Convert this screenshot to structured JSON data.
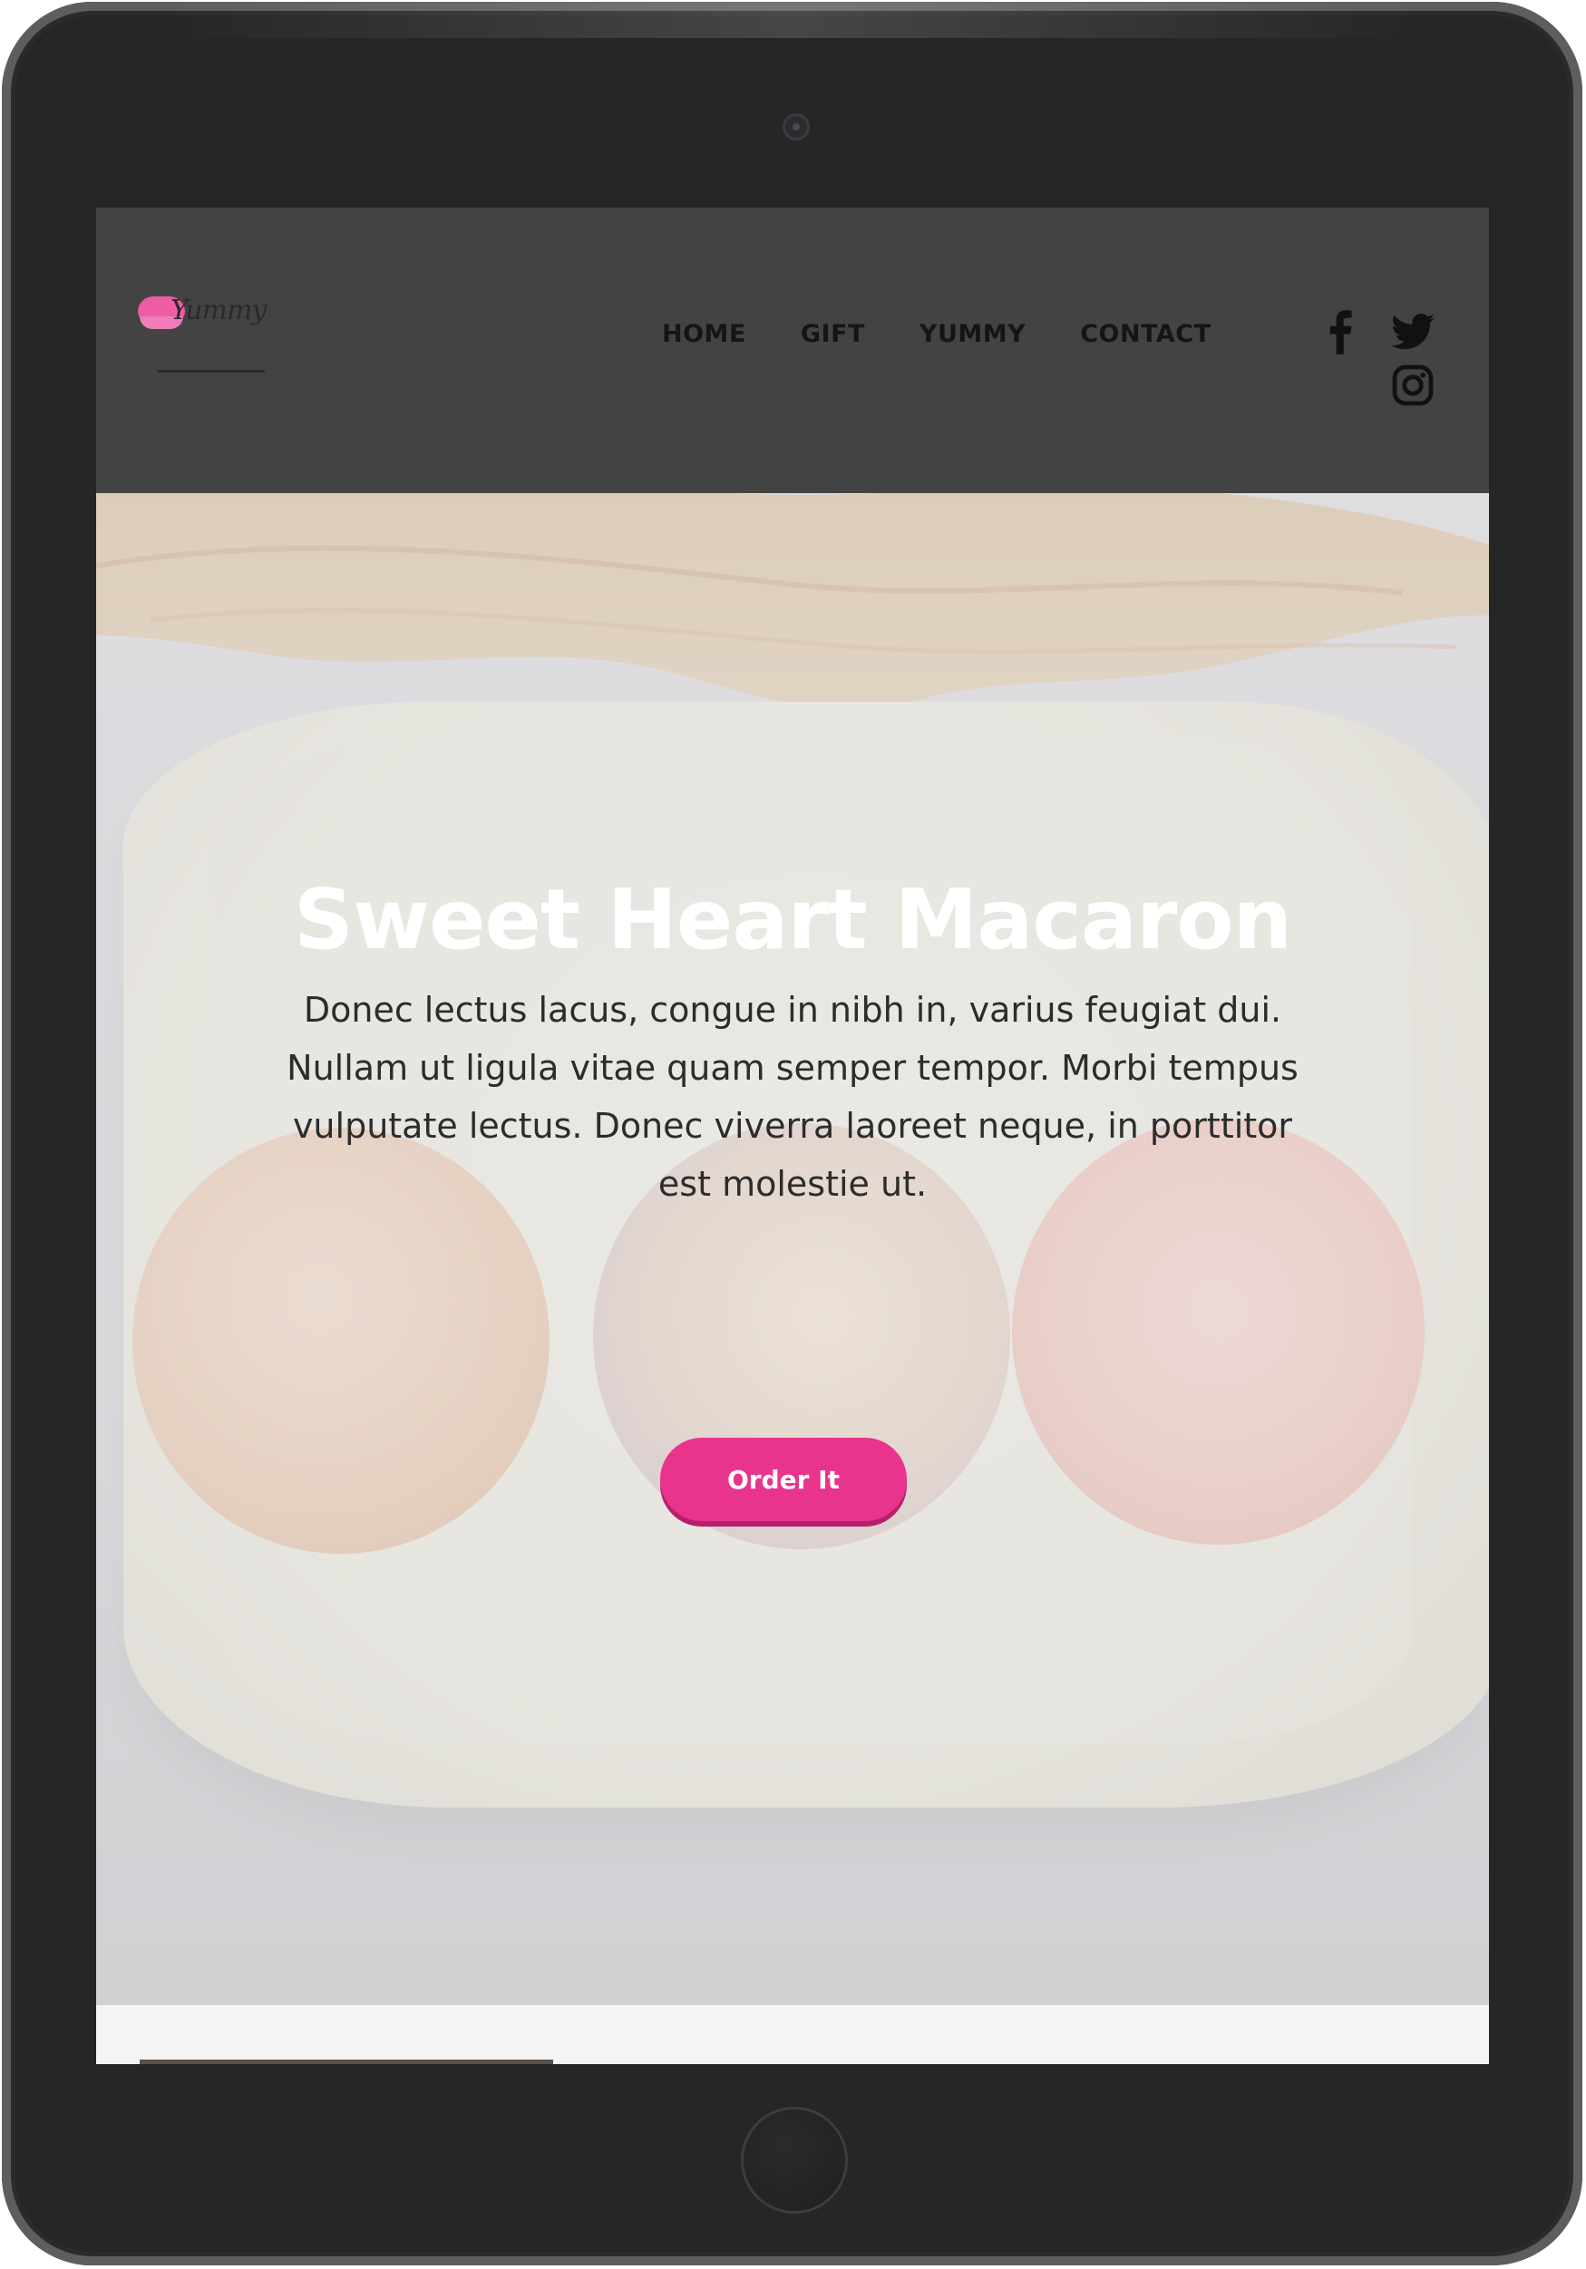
{
  "header": {
    "logo_text": "Yummy",
    "nav": [
      {
        "label": "HOME"
      },
      {
        "label": "GIFT"
      },
      {
        "label": "YUMMY"
      },
      {
        "label": "CONTACT"
      }
    ],
    "social": [
      "facebook-icon",
      "twitter-icon",
      "instagram-icon"
    ]
  },
  "hero": {
    "title": "Sweet Heart Macaron",
    "text": "Donec lectus lacus, congue in nibh in, varius feugiat dui. Nullam ut ligula vitae quam semper tempor. Morbi tempus vulputate lectus. Donec viverra laoreet neque, in porttitor est molestie ut.",
    "button_label": "Order It"
  },
  "colors": {
    "header_bg": "#434343",
    "accent": "#e8348c",
    "device_frame": "#262626"
  }
}
